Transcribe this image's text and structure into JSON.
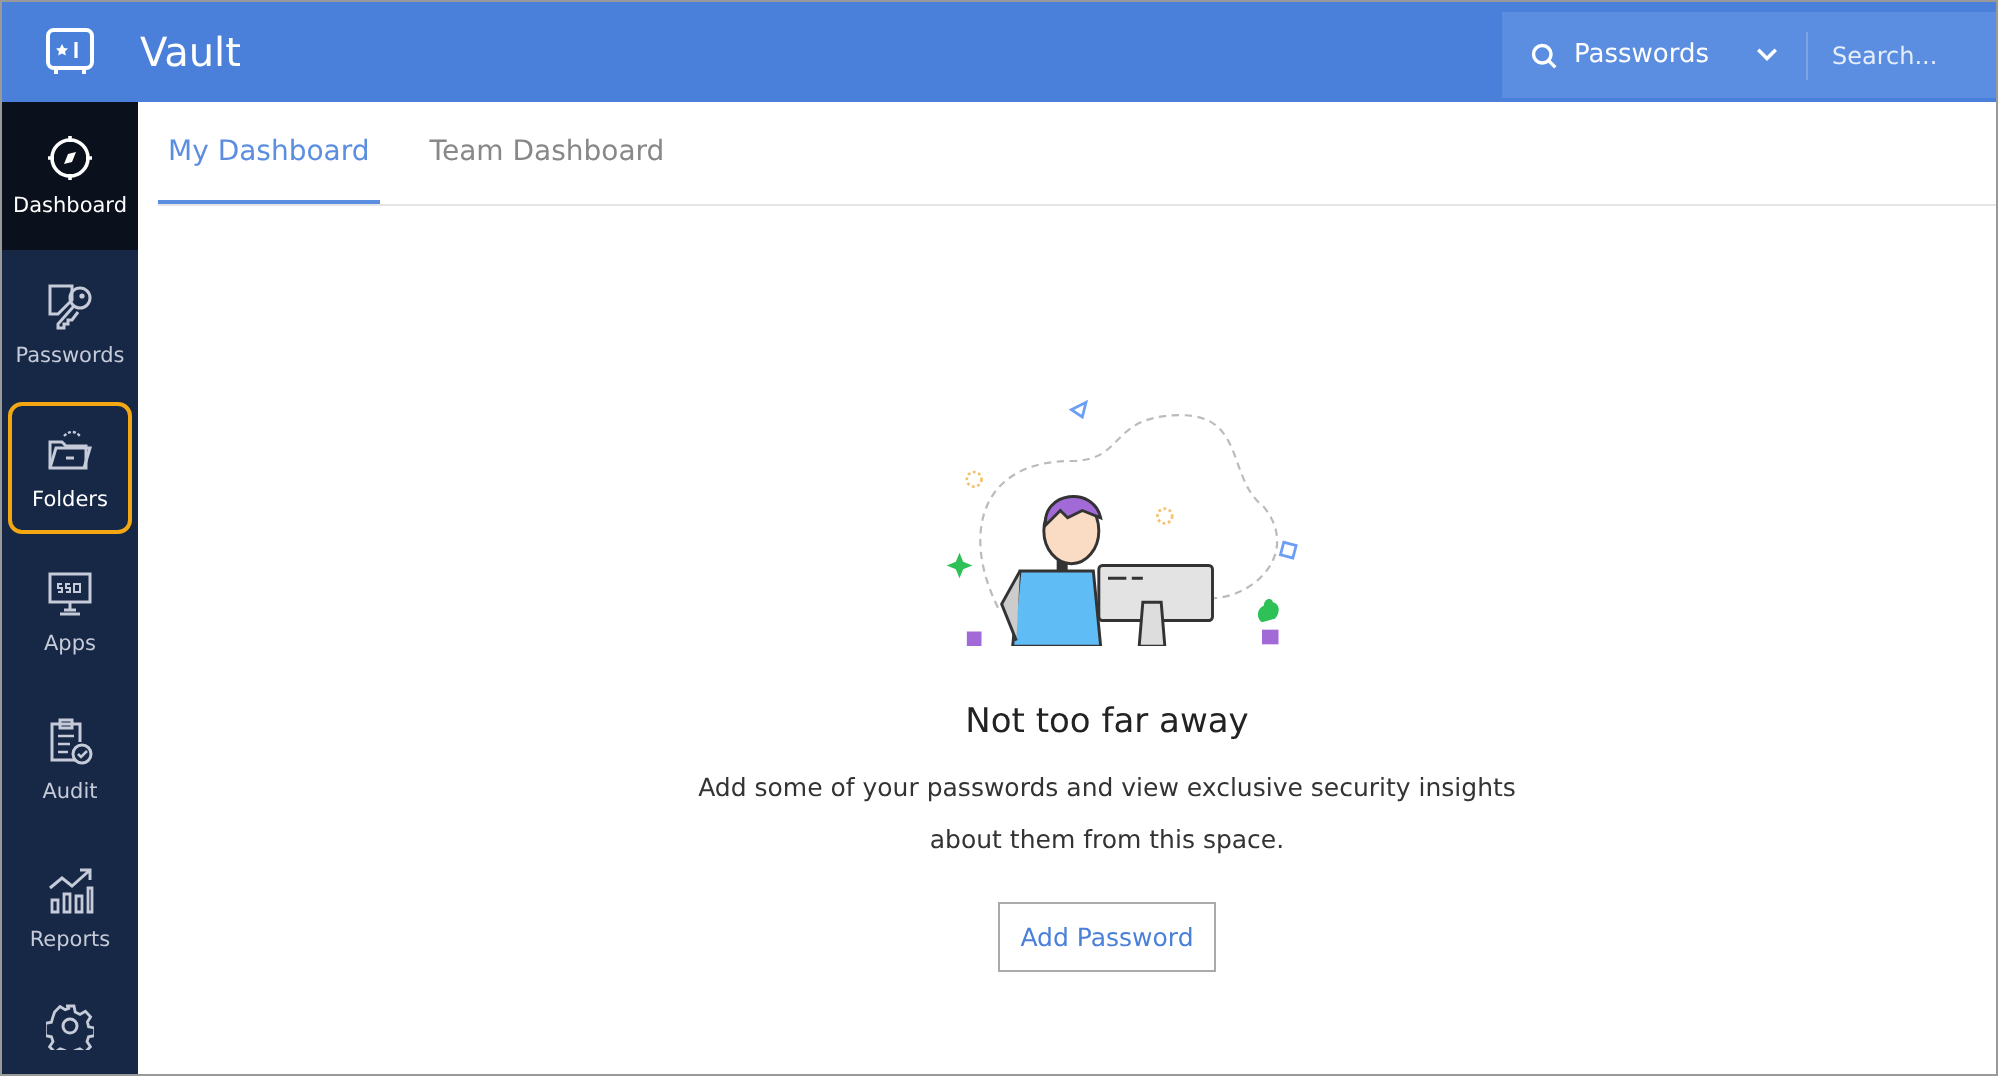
{
  "header": {
    "title": "Vault",
    "search_scope": "Passwords",
    "search_placeholder": "Search..."
  },
  "sidebar": {
    "items": [
      {
        "label": "Dashboard",
        "selected": true,
        "focused": false
      },
      {
        "label": "Passwords",
        "selected": false,
        "focused": false
      },
      {
        "label": "Folders",
        "selected": false,
        "focused": true
      },
      {
        "label": "Apps",
        "selected": false,
        "focused": false
      },
      {
        "label": "Audit",
        "selected": false,
        "focused": false
      },
      {
        "label": "Reports",
        "selected": false,
        "focused": false
      }
    ]
  },
  "tabs": [
    {
      "label": "My Dashboard",
      "selected": true
    },
    {
      "label": "Team Dashboard",
      "selected": false
    }
  ],
  "empty_state": {
    "title": "Not too far away",
    "message": "Add some of your passwords and view exclusive security insights about them from this space.",
    "button": "Add Password"
  }
}
